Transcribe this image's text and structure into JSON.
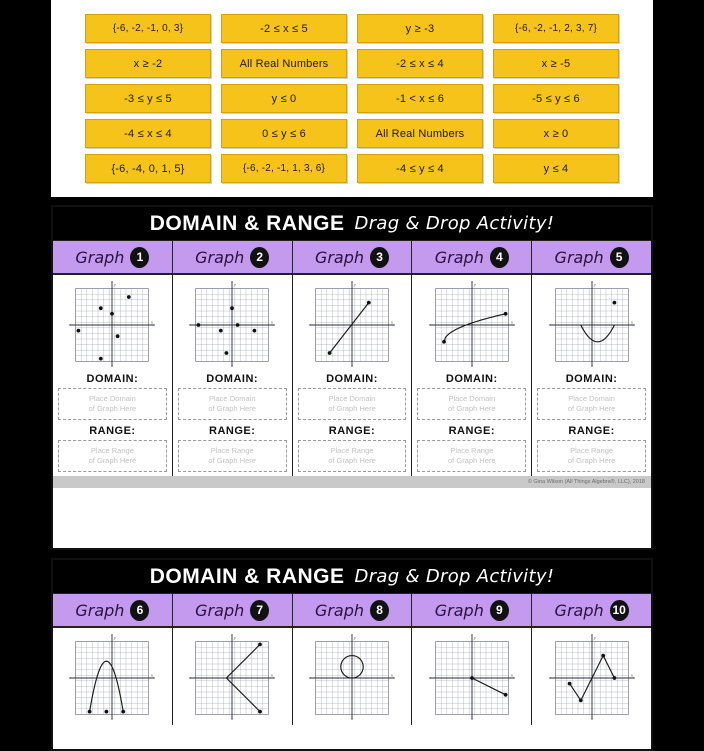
{
  "answer_bank": {
    "rows": [
      [
        {
          "text": "{-6, -2, -1, 0, 3}"
        },
        {
          "text": "-2 ≤ x ≤ 5"
        },
        {
          "text": "y ≥ -3"
        },
        {
          "text": "{-6, -2, -1, 2, 3, 7}"
        }
      ],
      [
        {
          "text": "x ≥ -2"
        },
        {
          "text": "All Real Numbers"
        },
        {
          "text": "-2 ≤ x ≤ 4"
        },
        {
          "text": "x ≥ -5"
        }
      ],
      [
        {
          "text": "-3 ≤ y ≤ 5"
        },
        {
          "text": "y ≤ 0"
        },
        {
          "text": "-1 < x ≤ 6"
        },
        {
          "text": "-5 ≤ y ≤ 6"
        }
      ],
      [
        {
          "text": "-4 ≤ x ≤ 4"
        },
        {
          "text": "0 ≤ y ≤ 6"
        },
        {
          "text": "All Real Numbers"
        },
        {
          "text": "x ≥ 0"
        }
      ],
      [
        {
          "text": "{-6, -4, 0, 1, 5}"
        },
        {
          "text": "{-6, -2, -1, 1, 3, 6}"
        },
        {
          "text": "-4 ≤ y ≤ 4"
        },
        {
          "text": "y ≤ 4"
        }
      ]
    ]
  },
  "card1": {
    "title_main": "DOMAIN & RANGE",
    "title_sub": "Drag & Drop Activity!",
    "graph_word": "Graph",
    "domain_label": "DOMAIN:",
    "range_label": "RANGE:",
    "domain_placeholder_line1": "Place Domain",
    "domain_placeholder_line2": "of Graph Here",
    "range_placeholder_line1": "Place Range",
    "range_placeholder_line2": "of Graph Here",
    "copyright": "© Gina Wilson (All Things Algebra®, LLC), 2018",
    "columns": [
      {
        "number": "1"
      },
      {
        "number": "2"
      },
      {
        "number": "3"
      },
      {
        "number": "4"
      },
      {
        "number": "5"
      }
    ]
  },
  "card2": {
    "title_main": "DOMAIN & RANGE",
    "title_sub": "Drag & Drop Activity!",
    "graph_word": "Graph",
    "columns": [
      {
        "number": "6"
      },
      {
        "number": "7"
      },
      {
        "number": "8"
      },
      {
        "number": "9"
      },
      {
        "number": "10"
      }
    ]
  },
  "colors": {
    "chip_fill": "#f5c31a",
    "chip_border": "#d3a206",
    "header_bg": "#000000",
    "column_header_bg": "#c49aee",
    "page_bg": "#000000"
  },
  "chart_data": [
    {
      "id": "graph-1",
      "type": "scatter",
      "title": "Graph 1",
      "xlabel": "x",
      "ylabel": "y",
      "xlim": [
        -7,
        7
      ],
      "ylim": [
        -7,
        7
      ],
      "grid": true,
      "points": [
        [
          -6,
          -1
        ],
        [
          -2,
          3
        ],
        [
          0,
          2
        ],
        [
          1,
          -2
        ],
        [
          3,
          5
        ],
        [
          -2,
          -6
        ]
      ]
    },
    {
      "id": "graph-2",
      "type": "scatter",
      "title": "Graph 2",
      "xlabel": "x",
      "ylabel": "y",
      "xlim": [
        -7,
        7
      ],
      "ylim": [
        -7,
        7
      ],
      "grid": true,
      "points": [
        [
          -6,
          0
        ],
        [
          -2,
          -1
        ],
        [
          0,
          3
        ],
        [
          1,
          0
        ],
        [
          4,
          -1
        ],
        [
          -1,
          -5
        ]
      ]
    },
    {
      "id": "graph-3",
      "type": "line",
      "title": "Graph 3",
      "xlabel": "x",
      "ylabel": "y",
      "xlim": [
        -7,
        7
      ],
      "ylim": [
        -7,
        7
      ],
      "grid": true,
      "shape": "segment",
      "endpoints_closed": [
        true,
        true
      ],
      "x": [
        -4,
        3
      ],
      "y": [
        -5,
        4
      ]
    },
    {
      "id": "graph-4",
      "type": "line",
      "title": "Graph 4",
      "xlabel": "x",
      "ylabel": "y",
      "xlim": [
        -7,
        7
      ],
      "ylim": [
        -7,
        7
      ],
      "grid": true,
      "shape": "radical",
      "endpoints_closed": [
        true,
        true
      ],
      "x": [
        -5,
        6
      ],
      "y": [
        -3,
        2
      ]
    },
    {
      "id": "graph-5",
      "type": "line",
      "title": "Graph 5",
      "xlabel": "x",
      "ylabel": "y",
      "xlim": [
        -7,
        7
      ],
      "ylim": [
        -7,
        7
      ],
      "grid": true,
      "shape": "parabola-up",
      "vertex": [
        1,
        -3
      ],
      "x": [
        -2,
        4
      ],
      "y": [
        0,
        4
      ]
    },
    {
      "id": "graph-6",
      "type": "line",
      "title": "Graph 6",
      "xlabel": "x",
      "ylabel": "y",
      "xlim": [
        -7,
        7
      ],
      "ylim": [
        -7,
        7
      ],
      "grid": true,
      "shape": "parabola-down",
      "vertex": [
        -1,
        3
      ],
      "x": [
        -4,
        2
      ],
      "y": [
        -6,
        -6
      ]
    },
    {
      "id": "graph-7",
      "type": "line",
      "title": "Graph 7",
      "xlabel": "x",
      "ylabel": "y",
      "xlim": [
        -7,
        7
      ],
      "ylim": [
        -7,
        7
      ],
      "grid": true,
      "shape": "sideways-v",
      "vertex": [
        -1,
        0
      ],
      "x": [
        5,
        5
      ],
      "y": [
        6,
        -6
      ]
    },
    {
      "id": "graph-8",
      "type": "line",
      "title": "Graph 8",
      "xlabel": "x",
      "ylabel": "y",
      "xlim": [
        -7,
        7
      ],
      "ylim": [
        -7,
        7
      ],
      "grid": true,
      "shape": "circle",
      "center": [
        0,
        2
      ],
      "radius": 2
    },
    {
      "id": "graph-9",
      "type": "line",
      "title": "Graph 9",
      "xlabel": "x",
      "ylabel": "y",
      "xlim": [
        -7,
        7
      ],
      "ylim": [
        -7,
        7
      ],
      "grid": true,
      "shape": "segment",
      "endpoints_closed": [
        true,
        true
      ],
      "x": [
        0,
        6
      ],
      "y": [
        0,
        -3
      ]
    },
    {
      "id": "graph-10",
      "type": "line",
      "title": "Graph 10",
      "xlabel": "x",
      "ylabel": "y",
      "xlim": [
        -7,
        7
      ],
      "ylim": [
        -7,
        7
      ],
      "grid": true,
      "shape": "zigzag",
      "points": [
        [
          -4,
          -1
        ],
        [
          -2,
          -4
        ],
        [
          2,
          4
        ],
        [
          4,
          0
        ]
      ]
    }
  ]
}
